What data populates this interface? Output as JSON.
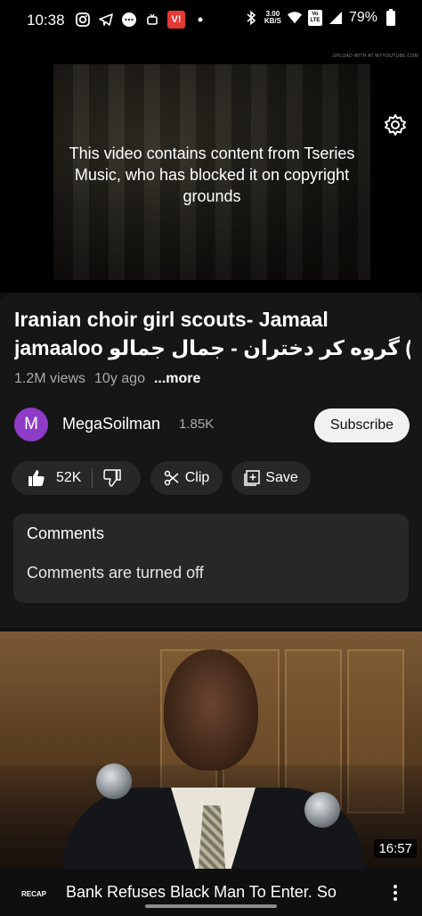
{
  "status_bar": {
    "time": "10:38",
    "net_speed_top": "3.00",
    "net_speed_unit": "KB/S",
    "volte": "Vo LTE",
    "battery": "79%",
    "app_badge": "V!"
  },
  "player": {
    "blocked_message": "This video contains content from Tseries Music, who has blocked it on copyright grounds",
    "watermark": "UPLOAD WITH AT MYYOUTUBE.COM"
  },
  "video": {
    "title_line1": "Iranian choir girl scouts- Jamaal",
    "title_line2": "jamaaloo گروه کر دختران - جمال جمالو (O...",
    "views": "1.2M views",
    "age": "10y ago",
    "more_label": "...more"
  },
  "channel": {
    "avatar_letter": "M",
    "avatar_color": "#8e3cc7",
    "name": "MegaSoilman",
    "subscribers": "1.85K",
    "subscribe_label": "Subscribe"
  },
  "actions": {
    "likes": "52K",
    "clip_label": "Clip",
    "save_label": "Save"
  },
  "comments": {
    "title": "Comments",
    "status": "Comments are turned off"
  },
  "next_video": {
    "duration": "16:57",
    "channel_logo_text": "RECAP",
    "title": "Bank Refuses Black Man To Enter. So"
  }
}
